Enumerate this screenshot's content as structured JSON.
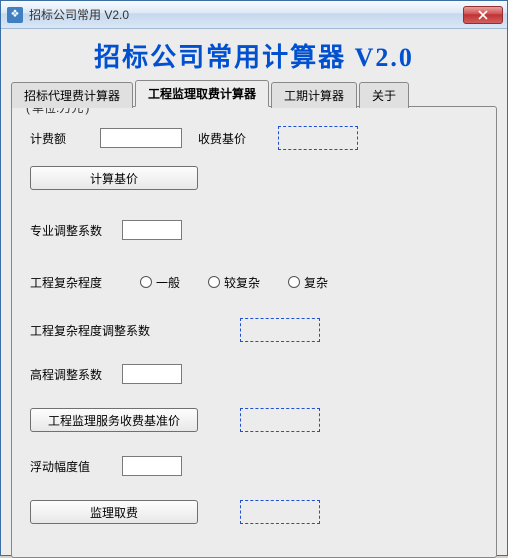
{
  "window": {
    "title": "招标公司常用 V2.0",
    "banner": "招标公司常用计算器 V2.0"
  },
  "tabs": [
    {
      "label": "招标代理费计算器"
    },
    {
      "label": "工程监理取费计算器"
    },
    {
      "label": "工期计算器"
    },
    {
      "label": "关于"
    }
  ],
  "group": {
    "legend_prefix": "(",
    "legend_unit": "单位:万元",
    "legend_suffix": ")"
  },
  "form": {
    "fee_amount_label": "计费额",
    "fee_amount_value": "",
    "charge_base_label": "收费基价",
    "calc_base_button": "计算基价",
    "pro_adjust_label": "专业调整系数",
    "pro_adjust_value": "",
    "complexity_label": "工程复杂程度",
    "complexity_options": [
      "一般",
      "较复杂",
      "复杂"
    ],
    "complexity_adjust_label": "工程复杂程度调整系数",
    "elevation_adjust_label": "高程调整系数",
    "elevation_adjust_value": "",
    "service_base_button": "工程监理服务收费基准价",
    "float_range_label": "浮动幅度值",
    "float_range_value": "",
    "supervision_fee_button": "监理取费"
  }
}
